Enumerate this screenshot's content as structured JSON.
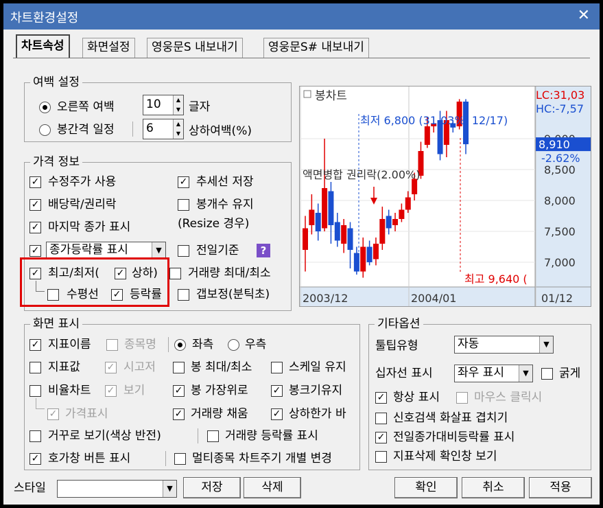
{
  "window": {
    "title": "차트환경설정",
    "close_glyph": "✕"
  },
  "tabs": [
    "차트속성",
    "화면설정",
    "영웅문S 내보내기",
    "영웅문S# 내보내기"
  ],
  "margin": {
    "legend": "여백 설정",
    "right_margin_label": "오른쪽 여백",
    "right_margin_value": "10",
    "right_margin_unit": "글자",
    "candle_spacing_label": "봉간격 일정",
    "candle_spacing_value": "6",
    "candle_spacing_unit": "상하여백(%)"
  },
  "price": {
    "legend": "가격 정보",
    "adjusted_price": "수정주가 사용",
    "trend_save": "추세선 저장",
    "dividend": "배당락/권리락",
    "keep_count": "봉개수 유지",
    "resize_note": "(Resize 경우)",
    "last_close": "마지막 종가 표시",
    "change_rate_combo": "종가등락률 표시",
    "prev_day_basis": "전일기준",
    "help_glyph": "?",
    "high_low": "최고/최저(",
    "up_down": "상하)",
    "volume_max_min": "거래량 최대/최소",
    "horizontal": "수평선",
    "change_rate": "등락률",
    "gap_adjust": "갭보정(분틱초)"
  },
  "chart_preview": {
    "title": "봉차트",
    "lc": "LC:31,03",
    "hc": "HC:-7,57",
    "low_annotation": "최저 6,800 (31.03%, 12/17)",
    "merge_annotation": "액면병합 권리락(2.00%)",
    "high_annotation": "최고 9,640 (",
    "price_axis": [
      "9,000",
      "8,500",
      "8,000",
      "7,500",
      "7,000"
    ],
    "current_price": "8,910",
    "current_change": "-2.62%",
    "date_axis": [
      "2003/12",
      "2004/01",
      "01/12"
    ],
    "colors": {
      "up": "#e00000",
      "down": "#1a4fd0",
      "grid": "#c8c8c8"
    },
    "candles": [
      {
        "o": 7200,
        "c": 7550,
        "h": 7750,
        "l": 6850,
        "up": true
      },
      {
        "o": 7600,
        "c": 7850,
        "h": 8100,
        "l": 7450,
        "up": true
      },
      {
        "o": 7800,
        "c": 7500,
        "h": 7950,
        "l": 7350,
        "up": false
      },
      {
        "o": 7550,
        "c": 8200,
        "h": 9000,
        "l": 7500,
        "up": true
      },
      {
        "o": 8150,
        "c": 7600,
        "h": 8300,
        "l": 7300,
        "up": false
      },
      {
        "o": 7650,
        "c": 7350,
        "h": 7800,
        "l": 7250,
        "up": false
      },
      {
        "o": 7300,
        "c": 7600,
        "h": 7700,
        "l": 7150,
        "up": true
      },
      {
        "o": 7550,
        "c": 7200,
        "h": 7650,
        "l": 6900,
        "up": false
      },
      {
        "o": 7150,
        "c": 6850,
        "h": 7250,
        "l": 6800,
        "up": false
      },
      {
        "o": 6850,
        "c": 7250,
        "h": 7400,
        "l": 6750,
        "up": true
      },
      {
        "o": 7250,
        "c": 7000,
        "h": 7350,
        "l": 6950,
        "up": false
      },
      {
        "o": 7050,
        "c": 7300,
        "h": 7400,
        "l": 6950,
        "up": true
      },
      {
        "o": 7300,
        "c": 7700,
        "h": 7900,
        "l": 7200,
        "up": true
      },
      {
        "o": 7750,
        "c": 7550,
        "h": 7850,
        "l": 7450,
        "up": false
      },
      {
        "o": 7600,
        "c": 7700,
        "h": 7800,
        "l": 7500,
        "up": true
      },
      {
        "o": 7700,
        "c": 7850,
        "h": 7950,
        "l": 7650,
        "up": true
      },
      {
        "o": 7850,
        "c": 8050,
        "h": 8150,
        "l": 7800,
        "up": true
      },
      {
        "o": 8100,
        "c": 8350,
        "h": 8450,
        "l": 8000,
        "up": true
      },
      {
        "o": 8400,
        "c": 8800,
        "h": 8950,
        "l": 8350,
        "up": true
      },
      {
        "o": 8900,
        "c": 9200,
        "h": 9350,
        "l": 8850,
        "up": true
      },
      {
        "o": 9200,
        "c": 9250,
        "h": 9350,
        "l": 9100,
        "up": true
      },
      {
        "o": 9300,
        "c": 8750,
        "h": 9450,
        "l": 8650,
        "up": false
      },
      {
        "o": 8900,
        "c": 9300,
        "h": 9450,
        "l": 8700,
        "up": true
      },
      {
        "o": 9250,
        "c": 9180,
        "h": 9300,
        "l": 9100,
        "up": false
      },
      {
        "o": 9200,
        "c": 9600,
        "h": 9640,
        "l": 9150,
        "up": true
      },
      {
        "o": 9600,
        "c": 8910,
        "h": 9640,
        "l": 8750,
        "up": false
      }
    ]
  },
  "screen": {
    "legend": "화면 표시",
    "indicator_name": "지표이름",
    "stock_name": "종목명",
    "left": "좌측",
    "right": "우측",
    "indicator_value": "지표값",
    "ohlc": "시고저",
    "candle_max_min": "봉 최대/최소",
    "scale_keep": "스케일 유지",
    "ratio_chart": "비율차트",
    "view": "보기",
    "candle_top": "봉 가장위로",
    "candle_size_keep": "봉크기유지",
    "price_display": "가격표시",
    "volume_fill": "거래량 채움",
    "limit_up_down": "상하한가 바",
    "reverse_view": "거꾸로 보기(색상 반전)",
    "volume_change_rate": "거래량 등락률 표시",
    "quote_button": "호가창 버튼 표시",
    "multi_cycle": "멀티종목 차트주기 개별 변경"
  },
  "other": {
    "legend": "기타옵션",
    "tooltip_label": "툴팁유형",
    "tooltip_value": "자동",
    "crosshair_label": "십자선 표시",
    "crosshair_value": "좌우 표시",
    "bold": "굵게",
    "always_show": "항상 표시",
    "mouse_click": "마우스 클릭시",
    "signal_overlap": "신호검색 화살표 겹치기",
    "prev_close_rate": "전일종가대비등락률 표시",
    "delete_confirm": "지표삭제 확인창 보기"
  },
  "footer": {
    "style_label": "스타일",
    "style_value": "",
    "save": "저장",
    "delete": "삭제",
    "ok": "확인",
    "cancel": "취소",
    "apply": "적용"
  }
}
